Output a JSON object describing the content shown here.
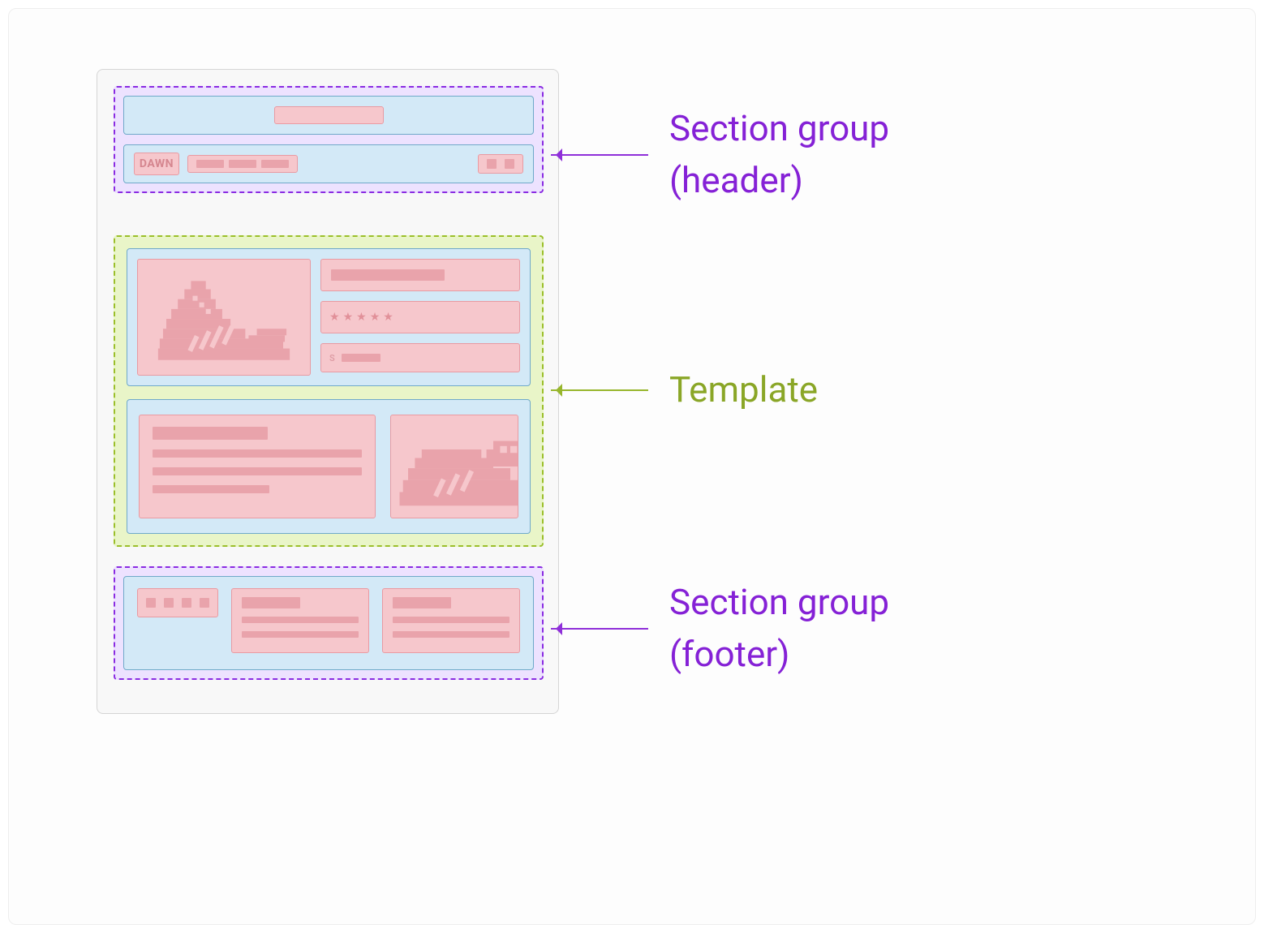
{
  "colors": {
    "group_purple_border": "#8a2be2",
    "group_purple_fill": "#ede2ff",
    "group_green_border": "#9bbf2a",
    "group_green_fill": "#e9f5c8",
    "section_fill": "#d3e9f7",
    "section_border": "#6fa9c9",
    "block_fill": "#f6c7cc",
    "block_border": "#e99aa2",
    "label_purple": "#8521d6",
    "label_green": "#8aa627"
  },
  "labels": {
    "header": "Section group\n(header)",
    "template": "Template",
    "footer": "Section group\n(footer)"
  },
  "header": {
    "logo_text": "DAWN",
    "menu_item_count": 3,
    "icon_count": 2
  },
  "template": {
    "product": {
      "star_count": 5,
      "price_prefix": "S"
    },
    "content": {
      "heading_lines": 1,
      "body_lines": 3
    }
  },
  "footer": {
    "social_icon_count": 4,
    "columns": 2
  }
}
